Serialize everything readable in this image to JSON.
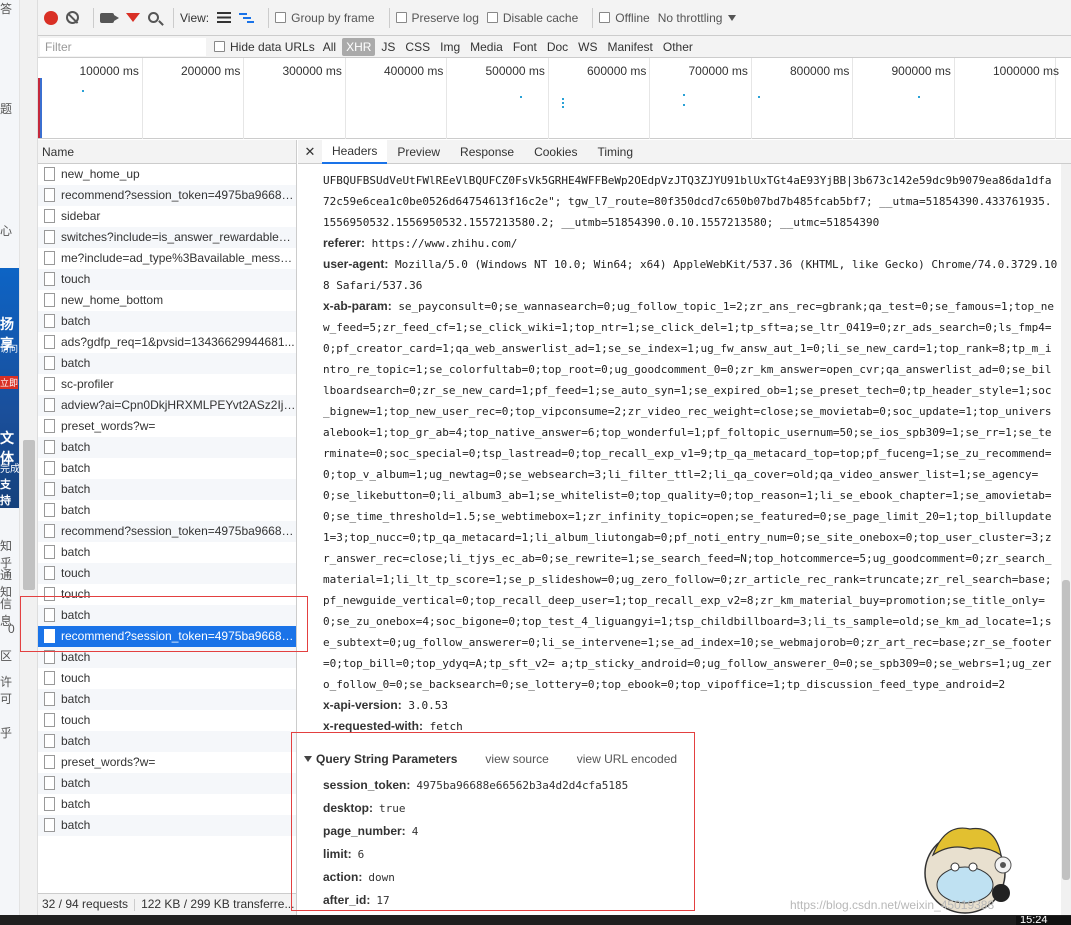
{
  "toolbar": {
    "view_label": "View:",
    "group_by_frame": "Group by frame",
    "preserve_log": "Preserve log",
    "disable_cache": "Disable cache",
    "offline": "Offline",
    "throttling": "No throttling"
  },
  "filterbar": {
    "filter_placeholder": "Filter",
    "hide_data_urls": "Hide data URLs",
    "types": [
      "All",
      "XHR",
      "JS",
      "CSS",
      "Img",
      "Media",
      "Font",
      "Doc",
      "WS",
      "Manifest",
      "Other"
    ],
    "active_type": "XHR"
  },
  "overview": {
    "ticks": [
      "100000 ms",
      "200000 ms",
      "300000 ms",
      "400000 ms",
      "500000 ms",
      "600000 ms",
      "700000 ms",
      "800000 ms",
      "900000 ms",
      "1000000 ms"
    ]
  },
  "requests": {
    "header": "Name",
    "items": [
      "new_home_up",
      "recommend?session_token=4975ba96688...",
      "sidebar",
      "switches?include=is_answer_rewardable%...",
      "me?include=ad_type%3Bavailable_messa...",
      "touch",
      "new_home_bottom",
      "batch",
      "ads?gdfp_req=1&pvsid=13436629944681...",
      "batch",
      "sc-profiler",
      "adview?ai=Cpn0DkjHRXMLPEYvt2ASz2IjA...",
      "preset_words?w=",
      "batch",
      "batch",
      "batch",
      "batch",
      "recommend?session_token=4975ba96688...",
      "batch",
      "touch",
      "touch",
      "batch",
      "recommend?session_token=4975ba96688...",
      "batch",
      "touch",
      "batch",
      "touch",
      "batch",
      "preset_words?w=",
      "batch",
      "batch",
      "batch"
    ],
    "selected_index": 22,
    "status_requests": "32 / 94 requests",
    "status_transferred": "122 KB / 299 KB transferre..."
  },
  "detail": {
    "tabs": [
      "Headers",
      "Preview",
      "Response",
      "Cookies",
      "Timing"
    ],
    "active_tab": "Headers",
    "cookie_tail": "UFBQUFBSUdVeUtFWlREeVlBQUFCZ0FsVk5GRHE4WFFBeWp2OEdpVzJTQ3ZJYU91blUxTGt4aE93YjBB|3b673c142e59dc9b9079ea86da1dfa72c59e6cea1c0be0526d64754613f16c2e\"; tgw_l7_route=80f350dcd7c650b07bd7b485fcab5bf7; __utma=51854390.433761935.1556950532.1556950532.1557213580.2; __utmb=51854390.0.10.1557213580; __utmc=51854390",
    "referer_key": "referer:",
    "referer_val": "https://www.zhihu.com/",
    "ua_key": "user-agent:",
    "ua_val": "Mozilla/5.0 (Windows NT 10.0; Win64; x64) AppleWebKit/537.36 (KHTML, like Gecko) Chrome/74.0.3729.108 Safari/537.36",
    "xab_key": "x-ab-param:",
    "xab_val": "se_payconsult=0;se_wannasearch=0;ug_follow_topic_1=2;zr_ans_rec=gbrank;qa_test=0;se_famous=1;top_new_feed=5;zr_feed_cf=1;se_click_wiki=1;top_ntr=1;se_click_del=1;tp_sft=a;se_ltr_0419=0;zr_ads_search=0;ls_fmp4=0;pf_creator_card=1;qa_web_answerlist_ad=1;se_se_index=1;ug_fw_answ_aut_1=0;li_se_new_card=1;top_rank=8;tp_m_intro_re_topic=1;se_colorfultab=0;top_root=0;ug_goodcomment_0=0;zr_km_answer=open_cvr;qa_answerlist_ad=0;se_billboardsearch=0;zr_se_new_card=1;pf_feed=1;se_auto_syn=1;se_expired_ob=1;se_preset_tech=0;tp_header_style=1;soc_bignew=1;top_new_user_rec=0;top_vipconsume=2;zr_video_rec_weight=close;se_movietab=0;soc_update=1;top_universalebook=1;top_gr_ab=4;top_native_answer=6;top_wonderful=1;pf_foltopic_usernum=50;se_ios_spb309=1;se_rr=1;se_terminate=0;soc_special=0;tsp_lastread=0;top_recall_exp_v1=9;tp_qa_metacard_top=top;pf_fuceng=1;se_zu_recommend=0;top_v_album=1;ug_newtag=0;se_websearch=3;li_filter_ttl=2;li_qa_cover=old;qa_video_answer_list=1;se_agency= 0;se_likebutton=0;li_album3_ab=1;se_whitelist=0;top_quality=0;top_reason=1;li_se_ebook_chapter=1;se_amovietab=0;se_time_threshold=1.5;se_webtimebox=1;zr_infinity_topic=open;se_featured=0;se_page_limit_20=1;top_billupdate1=3;top_nucc=0;tp_qa_metacard=1;li_album_liutongab=0;pf_noti_entry_num=0;se_site_onebox=0;top_user_cluster=3;zr_answer_rec=close;li_tjys_ec_ab=0;se_rewrite=1;se_search_feed=N;top_hotcommerce=5;ug_goodcomment=0;zr_search_material=1;li_lt_tp_score=1;se_p_slideshow=0;ug_zero_follow=0;zr_article_rec_rank=truncate;zr_rel_search=base;pf_newguide_vertical=0;top_recall_deep_user=1;top_recall_exp_v2=8;zr_km_material_buy=promotion;se_title_only=0;se_zu_onebox=4;soc_bigone=0;top_test_4_liguangyi=1;tsp_childbillboard=3;li_ts_sample=old;se_km_ad_locate=1;se_subtext=0;ug_follow_answerer=0;li_se_intervene=1;se_ad_index=10;se_webmajorob=0;zr_art_rec=base;zr_se_footer=0;top_bill=0;top_ydyq=A;tp_sft_v2= a;tp_sticky_android=0;ug_follow_answerer_0=0;se_spb309=0;se_webrs=1;ug_zero_follow_0=0;se_backsearch=0;se_lottery=0;top_ebook=0;top_vipoffice=1;tp_discussion_feed_type_android=2",
    "apiver_key": "x-api-version:",
    "apiver_val": "3.0.53",
    "xrw_key": "x-requested-with:",
    "xrw_val": "fetch",
    "qs_title": "Query String Parameters",
    "qs_view_source": "view source",
    "qs_view_url": "view URL encoded",
    "qs_params": [
      {
        "key": "session_token:",
        "value": "4975ba96688e66562b3a4d2d4cfa5185"
      },
      {
        "key": "desktop:",
        "value": "true"
      },
      {
        "key": "page_number:",
        "value": "4"
      },
      {
        "key": "limit:",
        "value": "6"
      },
      {
        "key": "action:",
        "value": "down"
      },
      {
        "key": "after_id:",
        "value": "17"
      }
    ]
  },
  "background_page": {
    "strip_chars": [
      "答",
      "题",
      "心",
      "知乎",
      "通知",
      "信息",
      "0",
      "区",
      "许可",
      "乎"
    ],
    "blue_chars": [
      "扬享",
      "访问",
      "立即",
      "文体",
      "完成",
      "支持"
    ]
  },
  "watermark": "https://blog.csdn.net/weixin_45019388",
  "clock": "15:24"
}
